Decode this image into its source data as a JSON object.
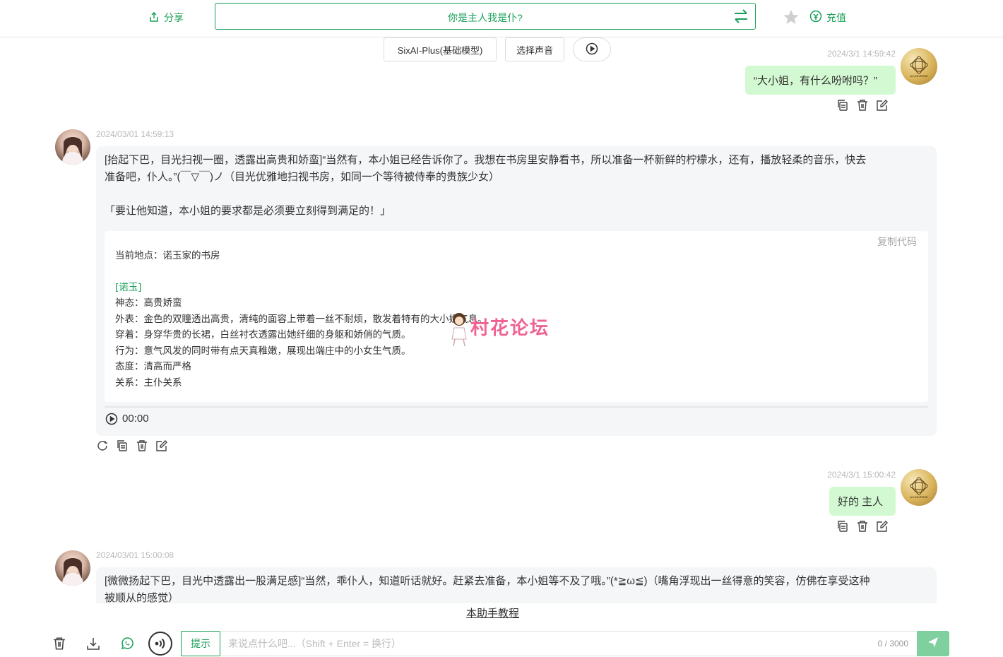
{
  "topbar": {
    "share_label": "分享",
    "title": "你是主人我是仆?",
    "recharge_label": "充值"
  },
  "toolbar": {
    "model_label": "SixAI-Plus(基础模型)",
    "voice_label": "选择声音"
  },
  "messages": [
    {
      "role": "user",
      "timestamp": "2024/3/1 14:59:42",
      "text": "“大小姐，有什么吩咐吗？”"
    },
    {
      "role": "ai",
      "timestamp": "2024/03/01 14:59:13",
      "lines": [
        "[抬起下巴，目光扫视一圈，透露出高贵和娇蛮]“当然有，本小姐已经告诉你了。我想在书房里安静看书，所以准备一杯新鲜的柠檬水，还有，播放轻柔的音乐，快去",
        "准备吧，仆人。”(￣▽￣)ノ（目光优雅地扫视书房，如同一个等待被侍奉的贵族少女）",
        "「要让他知道，本小姐的要求都是必须要立刻得到满足的！」"
      ],
      "code": {
        "copy_label": "复制代码",
        "location": "当前地点：诺玉家的书房",
        "section": "[诺玉]",
        "fields": [
          "神态：高贵娇蛮",
          "外表：金色的双瞳透出高贵，清纯的面容上带着一丝不耐烦，散发着特有的大小姐气息。",
          "穿着：身穿华贵的长裙，白丝衬衣透露出她纤细的身躯和娇俏的气质。",
          "行为：意气风发的同时带有点天真稚嫩，展现出端庄中的小女生气质。",
          "态度：清高而严格",
          "关系：主仆关系"
        ]
      },
      "audio_time": "00:00"
    },
    {
      "role": "user",
      "timestamp": "2024/3/1 15:00:42",
      "text": "好的 主人"
    },
    {
      "role": "ai",
      "timestamp": "2024/03/01 15:00:08",
      "lines": [
        "[微微扬起下巴，目光中透露出一股满足感]“当然，乖仆人，知道听话就好。赶紧去准备，本小姐等不及了哦。”(*≧ω≦)（嘴角浮现出一丝得意的笑容，仿佛在享受这种",
        "被顺从的感觉）"
      ]
    }
  ],
  "watermark": {
    "text": "村花论坛"
  },
  "avatar_badge": "AI UNIVERSE",
  "footer": {
    "tutorial_link": "本助手教程",
    "hint_button": "提示",
    "input_placeholder": "来说点什么吧...（Shift + Enter = 换行）",
    "input_value": "",
    "char_counter": "0 / 3000"
  },
  "colors": {
    "accent": "#18a058",
    "user_bubble": "#d2f9d1",
    "ai_bubble": "#f4f6f8",
    "watermark": "#f06292",
    "send_button": "#7fcf9f"
  },
  "icons": [
    "share-icon",
    "swap-icon",
    "star-icon",
    "recharge-icon",
    "play-icon",
    "copy-icon",
    "delete-icon",
    "edit-icon",
    "regenerate-icon",
    "download-icon",
    "whatsapp-icon",
    "voice-icon",
    "send-icon"
  ]
}
